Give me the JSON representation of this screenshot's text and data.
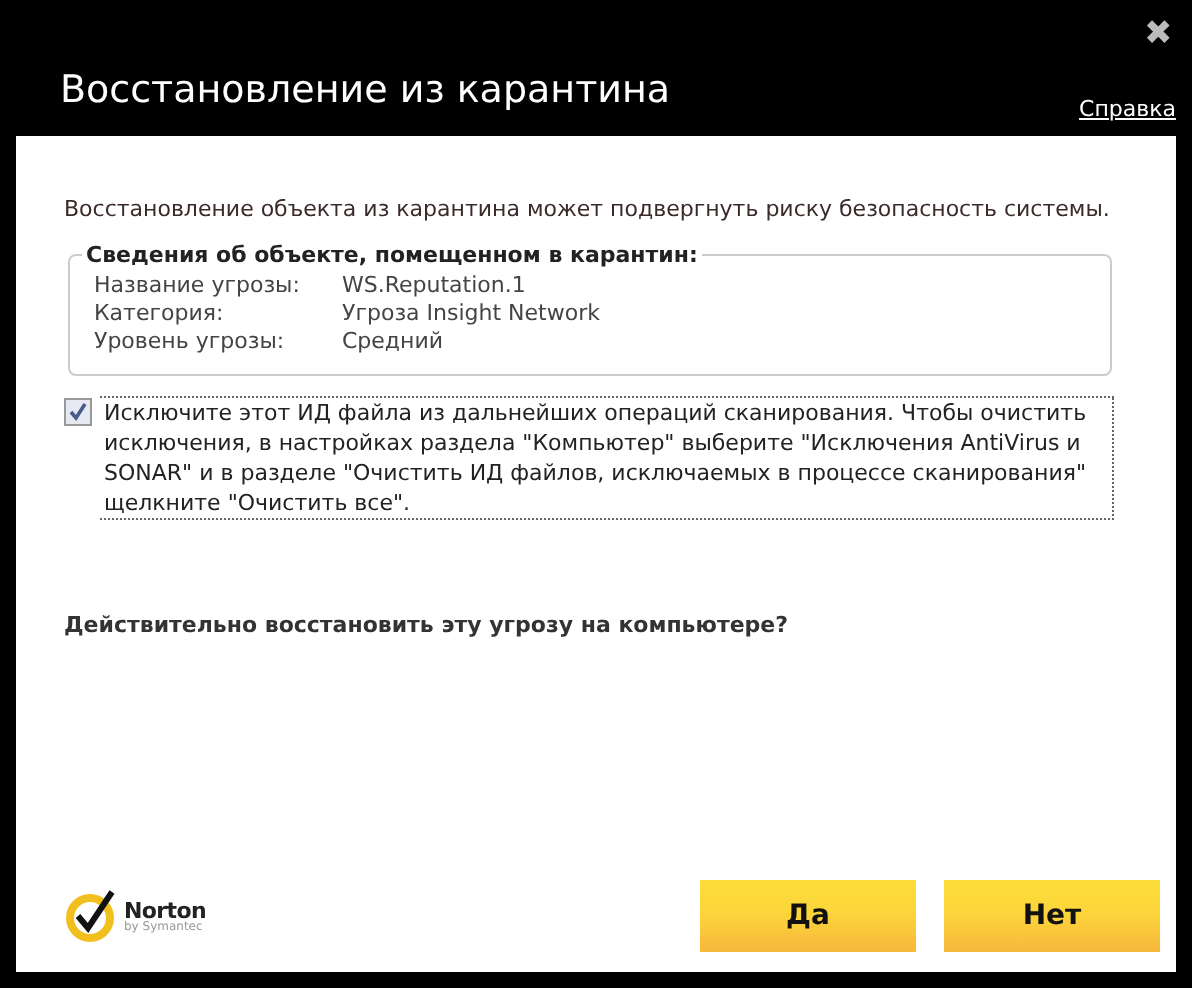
{
  "window": {
    "title": "Восстановление из карантина",
    "close": "✖",
    "help_link": "Справка"
  },
  "warning": "Восстановление объекта из карантина может подвергнуть риску безопасность системы.",
  "details": {
    "legend": "Сведения об объекте, помещенном в карантин:",
    "rows": [
      {
        "label": "Название угрозы:",
        "value": "WS.Reputation.1"
      },
      {
        "label": "Категория:",
        "value": "Угроза Insight Network"
      },
      {
        "label": "Уровень угрозы:",
        "value": "Средний"
      }
    ]
  },
  "exclude": {
    "checked": true,
    "text": "Исключите этот ИД файла из дальнейших операций сканирования. Чтобы очистить исключения, в настройках раздела \"Компьютер\" выберите \"Исключения AntiVirus и SONAR\" и в разделе \"Очистить ИД файлов, исключаемых в процессе сканирования\" щелкните \"Очистить все\"."
  },
  "question": "Действительно восстановить эту угрозу на компьютере?",
  "logo": {
    "name": "Norton",
    "tagline": "by Symantec"
  },
  "buttons": [
    "Да",
    "Нет"
  ]
}
